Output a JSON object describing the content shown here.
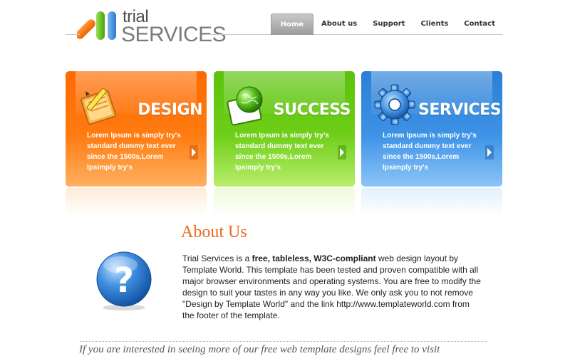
{
  "logo": {
    "line1": "trial",
    "line2": "SERVICES"
  },
  "nav": [
    {
      "label": "Home",
      "active": true
    },
    {
      "label": "About us"
    },
    {
      "label": "Support"
    },
    {
      "label": "Clients"
    },
    {
      "label": "Contact"
    }
  ],
  "features": [
    {
      "title": "DESIGN",
      "text": "Lorem Ipsum is simply try's standard dummy text ever since the 1500s,Lorem Ipsimply try's",
      "icon": "pencil-notepad-icon",
      "color": "#ff6a00"
    },
    {
      "title": "SUCCESS",
      "text": "Lorem Ipsum is simply try's standard dummy text ever since the 1500s,Lorem Ipsimply try's",
      "icon": "globe-frame-icon",
      "color": "#5cc20c"
    },
    {
      "title": "SERVICES",
      "text": "Lorem Ipsum is simply try's standard dummy text ever since the 1500s,Lorem Ipsimply try's",
      "icon": "gear-icon",
      "color": "#2b7fd6"
    }
  ],
  "about": {
    "title": "About Us",
    "text_before": "Trial Services is a ",
    "text_bold": "free, tableless, W3C-compliant",
    "text_after": " web design layout by Template World. This template has been tested and proven compatible with all major browser environments and operating systems. You are free to modify the design to suit your tastes in any way you like. We only ask you to not remove \"Design by Template World\" and the link http://www.templateworld.com from the footer of the template.",
    "icon": "question-mark-icon"
  },
  "footer_text": "If you are interested in seeing more of our free web template designs feel free to visit"
}
